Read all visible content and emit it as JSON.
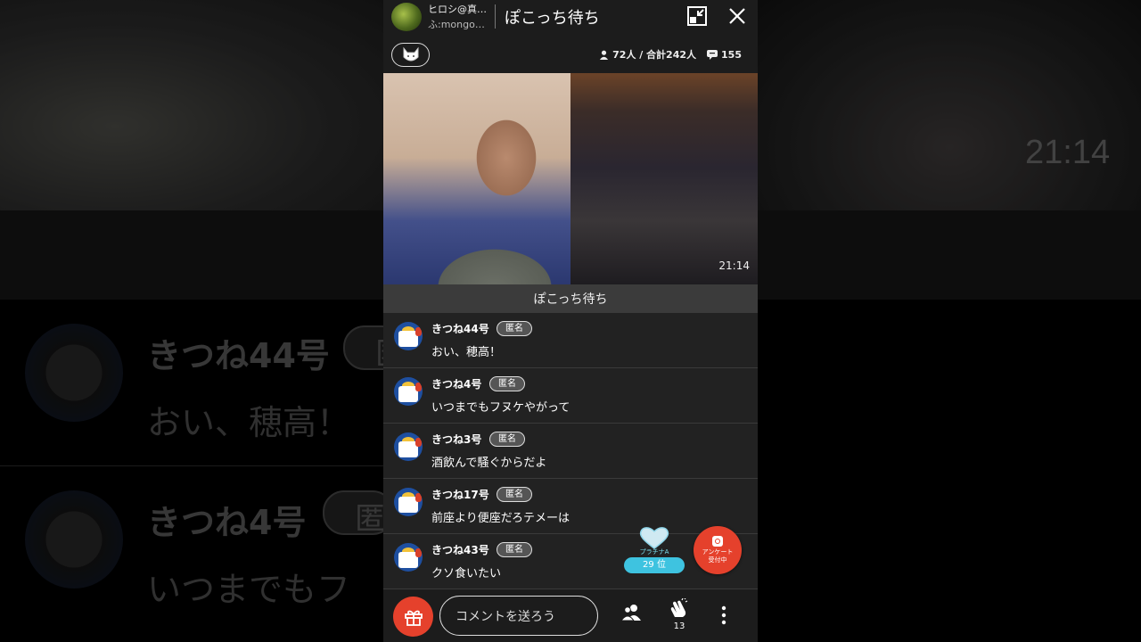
{
  "background": {
    "time": "21:14",
    "comments": [
      {
        "name": "きつね44号",
        "badge": "匿",
        "text": "おい、穂高！"
      },
      {
        "name": "きつね4号",
        "badge": "匿",
        "text": "いつまでもフ"
      }
    ]
  },
  "header": {
    "channel_name": "ヒロシ@真…",
    "channel_id": "ふ:mongo…",
    "title": "ぽこっち待ち"
  },
  "stats": {
    "viewers": "72人 / 合計242人",
    "comments": "155"
  },
  "video": {
    "time": "21:14"
  },
  "topic": "ぽこっち待ち",
  "comments": [
    {
      "name": "きつね44号",
      "badge": "匿名",
      "text": "おい、穂高！"
    },
    {
      "name": "きつね4号",
      "badge": "匿名",
      "text": "いつまでもフヌケやがって"
    },
    {
      "name": "きつね3号",
      "badge": "匿名",
      "text": "酒飲んで騒ぐからだよ"
    },
    {
      "name": "きつね17号",
      "badge": "匿名",
      "text": "前座より便座だろテメーは"
    },
    {
      "name": "きつね43号",
      "badge": "匿名",
      "text": "クソ食いたい"
    }
  ],
  "rank": {
    "label": "プラチナA",
    "position": "29 位"
  },
  "survey": {
    "line1": "アンケート",
    "line2": "受付中"
  },
  "bottom": {
    "placeholder": "コメントを送ろう",
    "clap_count": "13"
  },
  "colors": {
    "accent": "#e5412c",
    "rank": "#3ec3e0",
    "panel": "#222222"
  }
}
